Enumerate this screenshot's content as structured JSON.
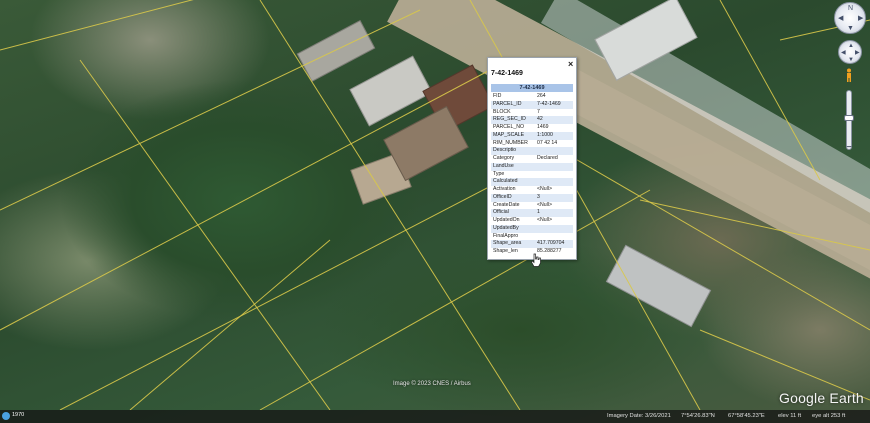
{
  "map": {
    "credit": "Image © 2023 CNES / Airbus",
    "logo": "Google Earth",
    "scale_label": "1970"
  },
  "popup": {
    "title": "7-42-1469",
    "header": "7-42-1469",
    "close_glyph": "×",
    "rows": [
      {
        "key": "FID",
        "value": "264"
      },
      {
        "key": "PARCEL_ID",
        "value": "7-42-1469"
      },
      {
        "key": "BLOCK",
        "value": "7"
      },
      {
        "key": "REG_SEC_ID",
        "value": "42"
      },
      {
        "key": "PARCEL_NO",
        "value": "1469"
      },
      {
        "key": "MAP_SCALE",
        "value": "1:1000"
      },
      {
        "key": "RIM_NUMBER",
        "value": "07 42 14"
      },
      {
        "key": "Descriptio",
        "value": ""
      },
      {
        "key": "Category",
        "value": "Declared"
      },
      {
        "key": "LandUse",
        "value": ""
      },
      {
        "key": "Type",
        "value": ""
      },
      {
        "key": "Calculated",
        "value": ""
      },
      {
        "key": "Activation",
        "value": "<Null>"
      },
      {
        "key": "OfficeID",
        "value": "3"
      },
      {
        "key": "CreateDate",
        "value": "<Null>"
      },
      {
        "key": "Official",
        "value": "1"
      },
      {
        "key": "UpdatedOn",
        "value": "<Null>"
      },
      {
        "key": "UpdatedBy",
        "value": ""
      },
      {
        "key": "FinalAppro",
        "value": ""
      },
      {
        "key": "Shape_area",
        "value": "417.709704"
      },
      {
        "key": "Shape_len",
        "value": "85.288277"
      }
    ]
  },
  "status": {
    "imagery_date": "Imagery Date: 3/26/2021",
    "lat": "7°54'26.83\"N",
    "lon": "67°58'45.23\"E",
    "elev": "elev  11 ft",
    "eye_alt": "eye alt   253 ft"
  },
  "controls": {
    "zoom_plus": "+",
    "zoom_minus": "−",
    "compass_n": "N"
  }
}
